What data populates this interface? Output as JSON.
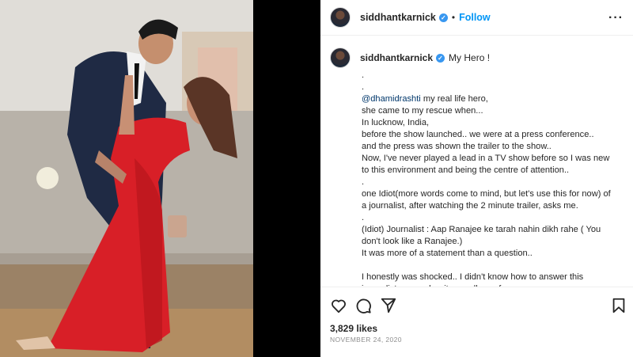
{
  "post": {
    "username": "siddhantkarnick",
    "follow_label": "Follow",
    "more_label": "···",
    "dot": "•",
    "verified_mark": "✓",
    "likes": "3,829 likes",
    "date": "NOVEMBER 24, 2020"
  },
  "caption": {
    "first": "My Hero !",
    "lines": [
      ".",
      ".",
      "@dhamidrashti my real life hero,",
      "she came to my rescue when...",
      "In lucknow, India,",
      "before the show launched.. we were at a press conference..",
      "and the press was shown the trailer to the show..",
      "Now, I've never played a lead in a TV show before so I was new",
      "to this environment and being the centre of attention..",
      ".",
      "one Idiot(more words come to mind, but let's use this for now) of",
      "a journalist, after watching the 2 minute trailer, asks me.",
      ".",
      "(Idiot) Journalist : Aap Ranajee ke tarah nahin dikh rahe ( You",
      "don't look like a Ranajee.)",
      "It was more of a statement than a question..",
      "",
      "I honestly was shocked.. I didn't know how to answer this",
      "journalist, remember it was all new for me.."
    ]
  },
  "icons": {
    "like": "heart-icon",
    "comment": "comment-icon",
    "share": "share-icon",
    "save": "bookmark-icon"
  },
  "colors": {
    "link": "#0095f6",
    "mention": "#00376b",
    "verified": "#3897f0",
    "dress": "#d81f27"
  }
}
